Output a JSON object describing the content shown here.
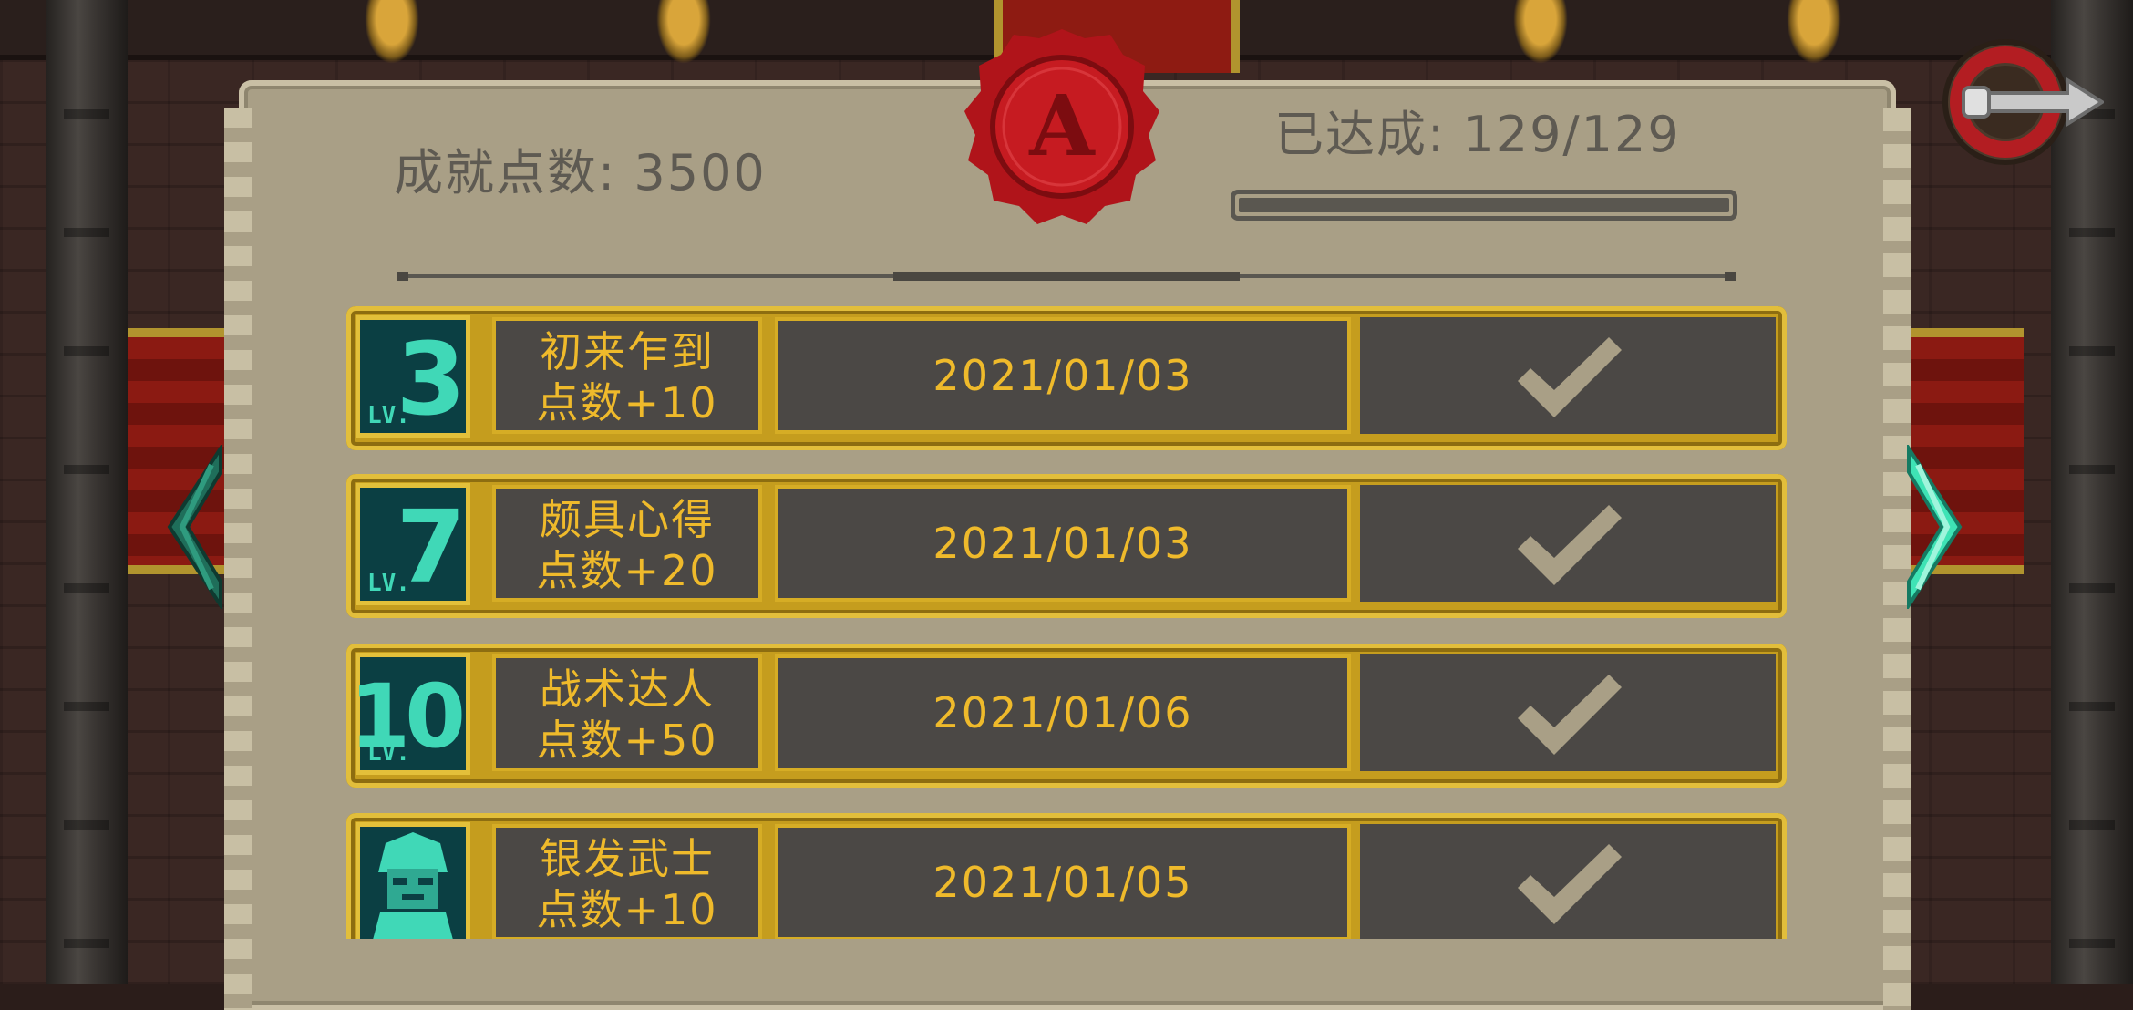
{
  "header": {
    "points_label": "成就点数: 3500",
    "progress_label": "已达成: 129/129",
    "progress_fraction": 1.0,
    "seal_letter": "A"
  },
  "colors": {
    "gold": "#efba2b",
    "teal": "#40d8b7",
    "parchment": "#a99f86",
    "cell": "#4b4845",
    "seal_red": "#b0141a"
  },
  "achievements": [
    {
      "level": "3",
      "lv_text": "LV.",
      "name": "初来乍到",
      "points": "点数+10",
      "date": "2021/01/03",
      "completed": true,
      "icon": "level-badge"
    },
    {
      "level": "7",
      "lv_text": "LV.",
      "name": "颇具心得",
      "points": "点数+20",
      "date": "2021/01/03",
      "completed": true,
      "icon": "level-badge"
    },
    {
      "level": "10",
      "lv_text": "LV.",
      "name": "战术达人",
      "points": "点数+50",
      "date": "2021/01/06",
      "completed": true,
      "icon": "level-badge"
    },
    {
      "level": "",
      "lv_text": "",
      "name": "银发武士",
      "points": "点数+10",
      "date": "2021/01/05",
      "completed": true,
      "icon": "silver-samurai-portrait-icon"
    }
  ],
  "nav": {
    "prev_icon": "chevron-left-icon",
    "next_icon": "chevron-right-icon",
    "back_icon": "back-arrow-icon"
  }
}
